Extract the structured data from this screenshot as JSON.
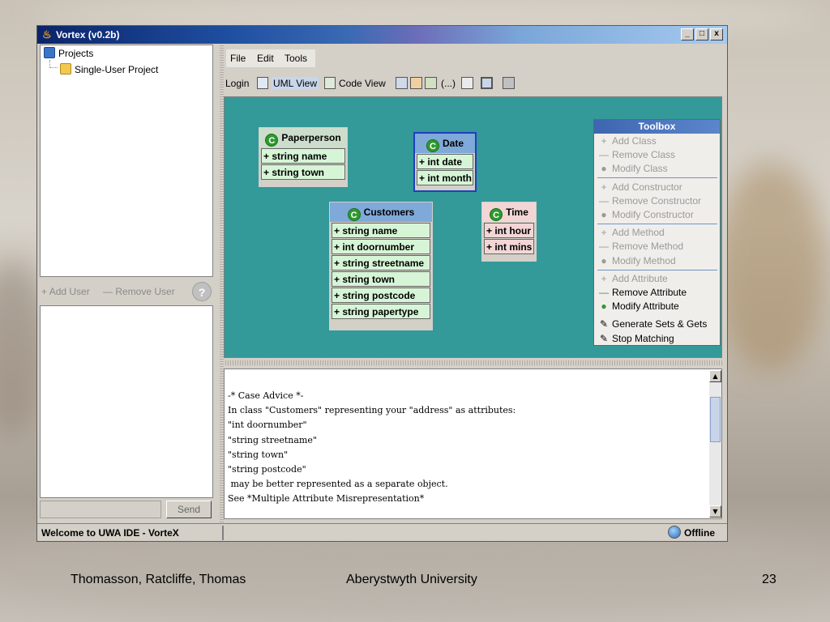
{
  "window": {
    "title": "Vortex (v0.2b)",
    "minimize": "_",
    "maximize": "□",
    "close": "x"
  },
  "tree": {
    "root": "Projects",
    "child": "Single-User Project"
  },
  "users": {
    "add": "Add User",
    "remove": "Remove User",
    "help_glyph": "?",
    "send": "Send"
  },
  "menu": [
    "File",
    "Edit",
    "Tools"
  ],
  "toolbar": {
    "login": "Login",
    "uml_view": "UML View",
    "code_view": "Code View",
    "ellipsis": "(...)"
  },
  "classes": [
    {
      "name": "Paperperson",
      "attributes": [
        "+ string name",
        "+ string town"
      ]
    },
    {
      "name": "Date",
      "attributes": [
        "+ int date",
        "+ int month"
      ]
    },
    {
      "name": "Customers",
      "attributes": [
        "+ string name",
        "+ int doornumber",
        "+ string streetname",
        "+ string town",
        "+ string postcode",
        "+ string papertype"
      ]
    },
    {
      "name": "Time",
      "attributes": [
        "+ int hour",
        "+ int mins"
      ]
    }
  ],
  "toolbox": {
    "title": "Toolbox",
    "items": [
      {
        "symbol": "+",
        "label": "Add Class",
        "enabled": false
      },
      {
        "symbol": "—",
        "label": "Remove Class",
        "enabled": false
      },
      {
        "symbol": "●",
        "label": "Modify Class",
        "enabled": false
      },
      {
        "symbol": "+",
        "label": "Add Constructor",
        "enabled": false
      },
      {
        "symbol": "—",
        "label": "Remove Constructor",
        "enabled": false
      },
      {
        "symbol": "●",
        "label": "Modify Constructor",
        "enabled": false
      },
      {
        "symbol": "+",
        "label": "Add Method",
        "enabled": false
      },
      {
        "symbol": "—",
        "label": "Remove Method",
        "enabled": false
      },
      {
        "symbol": "●",
        "label": "Modify Method",
        "enabled": false
      },
      {
        "symbol": "+",
        "label": "Add Attribute",
        "enabled": false
      },
      {
        "symbol": "—",
        "label": "Remove Attribute",
        "enabled": true
      },
      {
        "symbol": "●",
        "label": "Modify Attribute",
        "enabled": true
      },
      {
        "symbol": "✎",
        "label": "Generate Sets & Gets",
        "enabled": true
      },
      {
        "symbol": "✎",
        "label": "Stop Matching",
        "enabled": true
      }
    ]
  },
  "console": [
    "-* Case Advice *-",
    "In class \"Customers\" representing your \"address\" as attributes:",
    "\"int doornumber\"",
    "\"string streetname\"",
    "\"string town\"",
    "\"string postcode\"",
    " may be better represented as a separate object.",
    "See *Multiple Attribute Misrepresentation*"
  ],
  "status": {
    "text": "Welcome to UWA IDE - VorteX",
    "connection": "Offline"
  },
  "footer": {
    "authors": "Thomasson, Ratcliffe, Thomas",
    "institution": "Aberystwyth University",
    "page": "23"
  },
  "colors": {
    "canvas": "#339999",
    "title_bar": "#0a246a"
  }
}
